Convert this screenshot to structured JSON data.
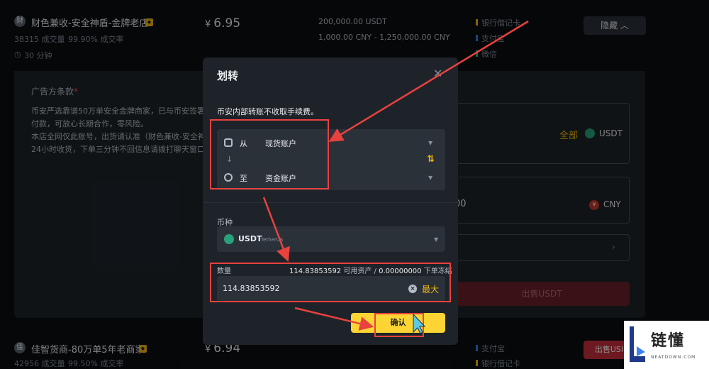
{
  "listing1": {
    "avatar": "财",
    "name": "财色兼收-安全神盾-金牌老店",
    "orders": "38315 成交量",
    "completion": "99.90% 成交率",
    "time": "30 分钟",
    "currency_symbol": "¥",
    "price": "6.95",
    "available": "200,000.00 USDT",
    "limit": "1,000.00 CNY - 1,250,000.00 CNY",
    "payments": [
      "银行借记卡",
      "支付宝",
      "微信"
    ],
    "hide_label": "隐藏"
  },
  "ad_terms": {
    "title": "广告方条款",
    "required_mark": "*",
    "lines": [
      "币安严选靠谱50万单安全金牌商家，已与币安签署冻结",
      "付款，可放心长期合作，零风险。",
      "本店全网仅此账号，出货请认准（财色兼收-安全神盾",
      "24小时收货，下单三分钟不回信息请拨打聊天窗口电"
    ]
  },
  "order_form": {
    "all_label": "全部",
    "coin": "USDT",
    "amount_partial": "00",
    "fiat": "CNY",
    "sell_label": "出售USDT"
  },
  "listing2": {
    "avatar": "佳",
    "name": "佳智货商-80万单5年老商家",
    "orders": "42956 成交量",
    "completion": "99.50% 成交率",
    "currency_symbol": "¥",
    "price": "6.94",
    "payments": [
      "支付宝",
      "银行借记卡"
    ],
    "sell_label": "出售USI"
  },
  "dialog": {
    "title": "划转",
    "note": "币安内部转账不收取手续费。",
    "from_label": "从",
    "from_account": "现货账户",
    "to_label": "至",
    "to_account": "资金账户",
    "coin_label": "币种",
    "coin": "USDT",
    "coin_full": "TetherUS",
    "qty_label": "数量",
    "available_value": "114.83853592",
    "available_label": "可用资产",
    "frozen_value": "0.00000000",
    "frozen_label": "下单冻结",
    "qty_value": "114.83853592",
    "max_label": "最大",
    "confirm_label": "确认"
  },
  "watermark": {
    "text": "链懂",
    "url": "NEATDOWN.COM"
  },
  "colors": {
    "accent_yellow": "#fcd535",
    "annotation_red": "#e8423f",
    "sell_red": "#c62e3d",
    "usdt_green": "#26a17b"
  }
}
